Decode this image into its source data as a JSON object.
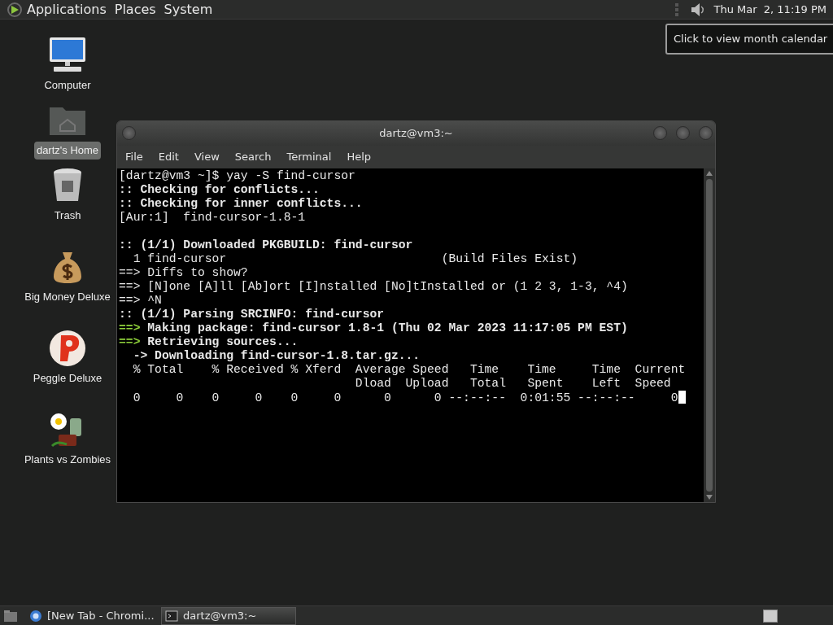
{
  "top_panel": {
    "menus": [
      "Applications",
      "Places",
      "System"
    ],
    "clock": "Thu Mar  2, 11:19 PM"
  },
  "tooltip": "Click to view month calendar",
  "desktop_icons": [
    {
      "label": "Computer",
      "kind": "computer",
      "selected": false
    },
    {
      "label": "dartz's Home",
      "kind": "home",
      "selected": true
    },
    {
      "label": "Trash",
      "kind": "trash",
      "selected": false
    },
    {
      "label": "Big Money Deluxe",
      "kind": "moneybag",
      "selected": false
    },
    {
      "label": "Peggle Deluxe",
      "kind": "peggle",
      "selected": false
    },
    {
      "label": "Plants vs Zombies",
      "kind": "plants",
      "selected": false
    }
  ],
  "window": {
    "title": "dartz@vm3:~",
    "menu": [
      "File",
      "Edit",
      "View",
      "Search",
      "Terminal",
      "Help"
    ],
    "terminal_lines": [
      {
        "segments": [
          {
            "text": "[dartz@vm3 ~]$ yay -S find-cursor",
            "kind": "plain"
          }
        ]
      },
      {
        "segments": [
          {
            "text": ":: Checking for conflicts...",
            "kind": "bold"
          }
        ]
      },
      {
        "segments": [
          {
            "text": ":: Checking for inner conflicts...",
            "kind": "bold"
          }
        ]
      },
      {
        "segments": [
          {
            "text": "[Aur:1]  find-cursor-1.8-1",
            "kind": "plain"
          }
        ]
      },
      {
        "blank_before": true,
        "segments": [
          {
            "text": ":: (1/1) Downloaded PKGBUILD: find-cursor",
            "kind": "bold"
          }
        ]
      },
      {
        "segments": [
          {
            "text": "  1 find-cursor                              (Build Files Exist)",
            "kind": "plain"
          }
        ]
      },
      {
        "segments": [
          {
            "text": "==> Diffs to show?",
            "kind": "plain"
          }
        ]
      },
      {
        "segments": [
          {
            "text": "==> [N]one [A]ll [Ab]ort [I]nstalled [No]tInstalled or (1 2 3, 1-3, ^4)",
            "kind": "plain"
          }
        ]
      },
      {
        "segments": [
          {
            "text": "==> ^N",
            "kind": "plain"
          }
        ]
      },
      {
        "segments": [
          {
            "text": ":: (1/1) Parsing SRCINFO: find-cursor",
            "kind": "bold"
          }
        ]
      },
      {
        "segments": [
          {
            "text": "==>",
            "kind": "green"
          },
          {
            "text": " Making package: find-cursor 1.8-1 (Thu 02 Mar 2023 11:17:05 PM EST)",
            "kind": "bold"
          }
        ]
      },
      {
        "segments": [
          {
            "text": "==>",
            "kind": "green"
          },
          {
            "text": " Retrieving sources...",
            "kind": "bold"
          }
        ]
      },
      {
        "segments": [
          {
            "text": "  -> Downloading find-cursor-1.8.tar.gz...",
            "kind": "bold"
          }
        ]
      },
      {
        "segments": [
          {
            "text": "  % Total    % Received % Xferd  Average Speed   Time    Time     Time  Current",
            "kind": "plain"
          }
        ]
      },
      {
        "segments": [
          {
            "text": "                                 Dload  Upload   Total   Spent    Left  Speed",
            "kind": "plain"
          }
        ]
      },
      {
        "segments": [
          {
            "text": "  0     0    0     0    0     0      0      0 --:--:--  0:01:55 --:--:--     0",
            "kind": "plain"
          }
        ]
      }
    ]
  },
  "taskbar": {
    "tasks": [
      {
        "label": "[New Tab - Chromi...",
        "kind": "browser",
        "selected": false
      },
      {
        "label": "dartz@vm3:~",
        "kind": "terminal",
        "selected": true
      }
    ]
  }
}
